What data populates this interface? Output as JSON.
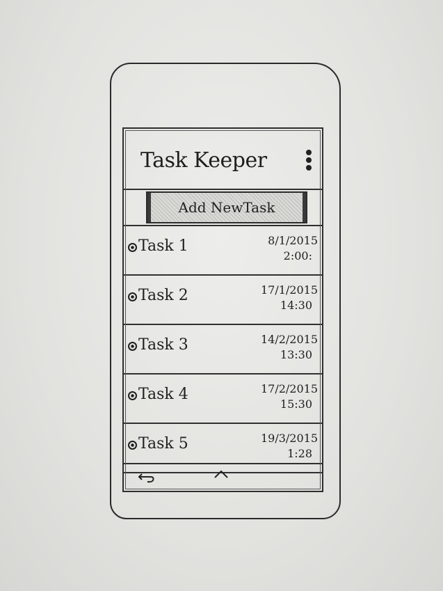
{
  "app": {
    "title": "Task Keeper"
  },
  "toolbar": {
    "add_label": "Add NewTask",
    "menu_icon": "overflow-menu-icon"
  },
  "tasks": [
    {
      "name": "Task 1",
      "date": "8/1/2015",
      "time": "2:00:"
    },
    {
      "name": "Task 2",
      "date": "17/1/2015",
      "time": "14:30"
    },
    {
      "name": "Task 3",
      "date": "14/2/2015",
      "time": "13:30"
    },
    {
      "name": "Task 4",
      "date": "17/2/2015",
      "time": "15:30"
    },
    {
      "name": "Task 5",
      "date": "19/3/2015",
      "time": "1:28"
    }
  ],
  "nav": {
    "back_icon": "back-icon",
    "up_icon": "chevron-up-icon"
  },
  "colors": {
    "ink": "#1f1f1f",
    "paper": "#e4e4e2"
  }
}
